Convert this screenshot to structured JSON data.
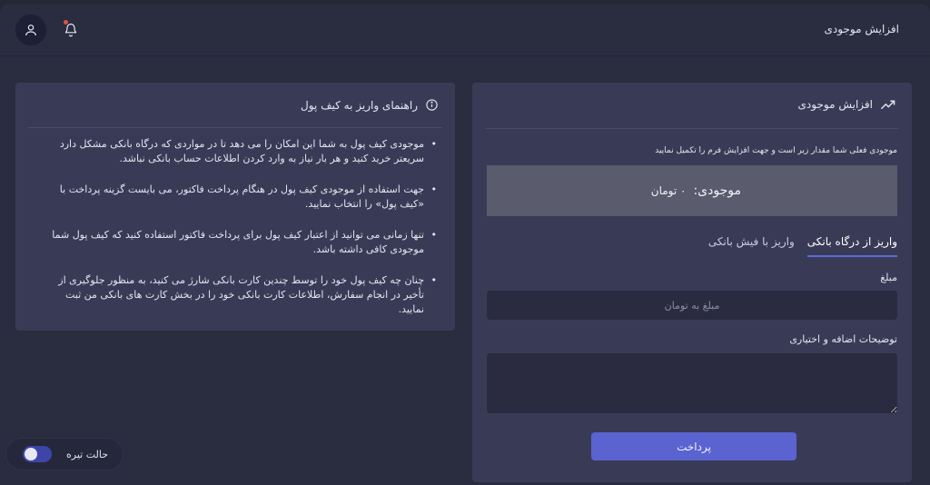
{
  "header": {
    "title": "افزایش موجودی",
    "user_icon": "user-icon",
    "notification_icon": "bell-icon",
    "notification_dot_color": "#e0533d"
  },
  "guide": {
    "title": "راهنمای واریز به کیف پول",
    "icon": "info-icon",
    "items": [
      "موجودی کیف پول به شما این امکان را می دهد تا در مواردی که درگاه بانکی مشکل دارد سریعتر خرید کنید و هر بار نیاز به وارد کردن اطلاعات حساب بانکی نباشد.",
      "جهت استفاده از موجودی کیف پول در هنگام پرداخت فاکتور، می بایست گزینه پرداخت با «کیف پول» را انتخاب نمایید.",
      "تنها زمانی می توانید از اعتبار کیف پول برای پرداخت فاکتور استفاده کنید که کیف پول شما موجودی کافی داشته باشد.",
      "چنان چه کیف پول خود را توسط چندین کارت بانکی شارژ می کنید، به منظور جلوگیری از تأخیر در انجام سفارش، اطلاعات کارت بانکی خود را در بخش کارت های بانکی من ثبت نمایید."
    ]
  },
  "wallet": {
    "title": "افزایش موجودی",
    "icon": "trending-up-icon",
    "note": "موجودی فعلی شما مقدار زیر است و جهت افزایش فرم را تکمیل نمایید",
    "balance_label": "موجودی:",
    "balance_value": "۰ تومان",
    "tabs": [
      {
        "label": "واریز از درگاه بانکی",
        "active": true
      },
      {
        "label": "واریز با فیش بانکی",
        "active": false
      }
    ],
    "amount_label": "مبلغ",
    "amount_placeholder": "مبلغ به تومان",
    "description_label": "توضیحات اضافه و اختیاری",
    "pay_button": "پرداخت",
    "accent_color": "#5a63cf"
  },
  "darkmode": {
    "label": "حالت تیره",
    "enabled": true
  }
}
